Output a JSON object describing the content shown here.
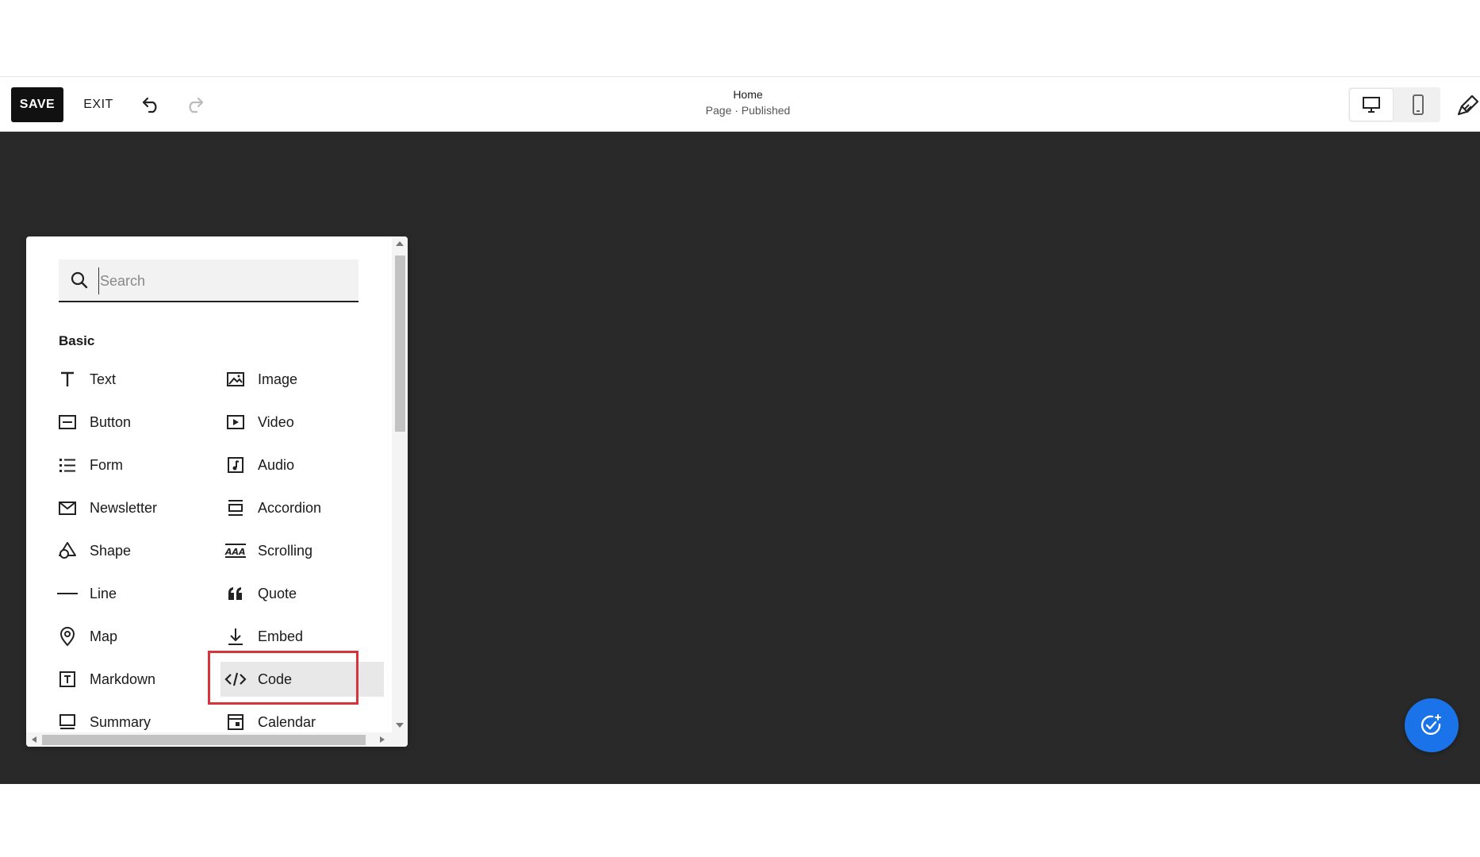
{
  "toolbar": {
    "save_label": "SAVE",
    "exit_label": "EXIT",
    "page_title": "Home",
    "page_status": "Page · Published"
  },
  "panel": {
    "search": {
      "placeholder": "Search",
      "value": ""
    },
    "section_label": "Basic",
    "items": [
      {
        "label": "Text",
        "icon": "text-icon"
      },
      {
        "label": "Image",
        "icon": "image-icon"
      },
      {
        "label": "Button",
        "icon": "button-icon"
      },
      {
        "label": "Video",
        "icon": "video-icon"
      },
      {
        "label": "Form",
        "icon": "form-icon"
      },
      {
        "label": "Audio",
        "icon": "audio-icon"
      },
      {
        "label": "Newsletter",
        "icon": "mail-icon"
      },
      {
        "label": "Accordion",
        "icon": "accordion-icon"
      },
      {
        "label": "Shape",
        "icon": "shape-icon"
      },
      {
        "label": "Scrolling",
        "icon": "scrolling-icon"
      },
      {
        "label": "Line",
        "icon": "line-icon"
      },
      {
        "label": "Quote",
        "icon": "quote-icon"
      },
      {
        "label": "Map",
        "icon": "map-pin-icon"
      },
      {
        "label": "Embed",
        "icon": "embed-icon"
      },
      {
        "label": "Markdown",
        "icon": "markdown-icon"
      },
      {
        "label": "Code",
        "icon": "code-icon"
      },
      {
        "label": "Summary",
        "icon": "summary-icon"
      },
      {
        "label": "Calendar",
        "icon": "calendar-icon"
      }
    ]
  },
  "colors": {
    "canvas": "#292929",
    "highlight_border": "#d7333a",
    "fab": "#1a73e8",
    "save_button": "#111111"
  }
}
